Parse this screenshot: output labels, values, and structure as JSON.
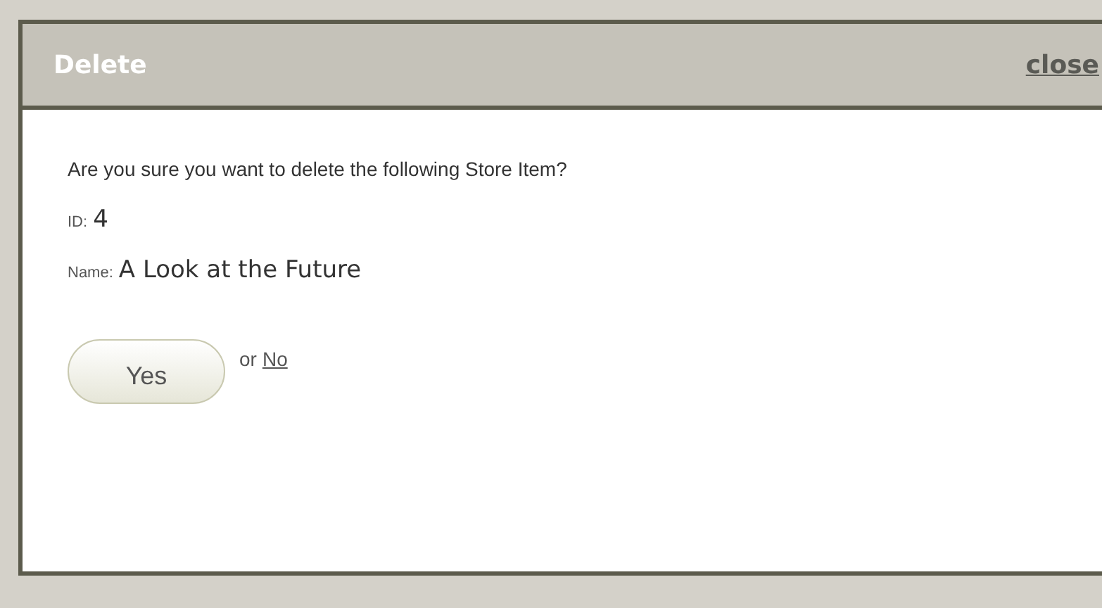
{
  "dialog": {
    "title": "Delete",
    "close": "close",
    "message": "Are you sure you want to delete the following Store Item?",
    "fields": [
      {
        "label": "ID:",
        "value": "4"
      },
      {
        "label": "Name:",
        "value": "A Look at the Future"
      }
    ],
    "confirm": "Yes",
    "separator": "or",
    "cancel": "No"
  }
}
